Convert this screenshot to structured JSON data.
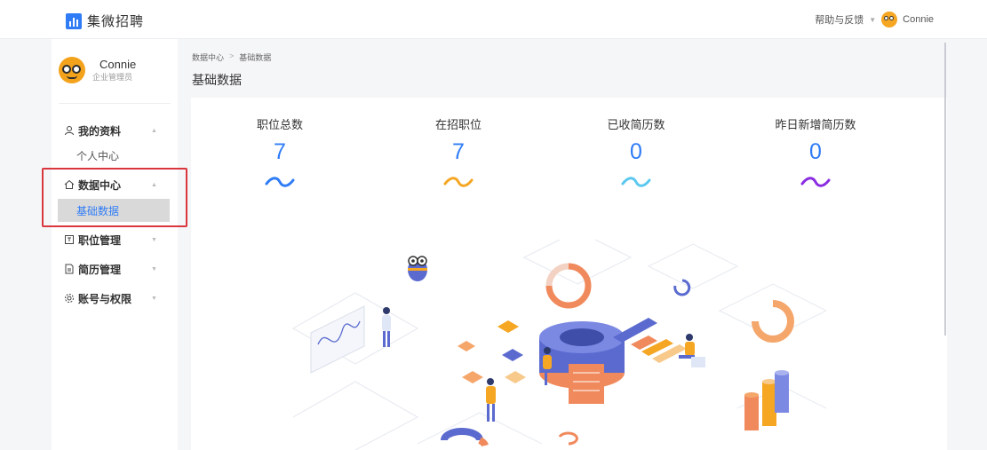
{
  "app": {
    "name": "集微招聘"
  },
  "header": {
    "help_label": "帮助与反馈",
    "user_name": "Connie"
  },
  "sidebar": {
    "user": {
      "name": "Connie",
      "role": "企业管理员"
    },
    "groups": [
      {
        "label": "我的资料",
        "icon": "user-icon",
        "sub": [
          "个人中心"
        ]
      },
      {
        "label": "数据中心",
        "icon": "home-icon",
        "sub": [
          "基础数据"
        ],
        "active_sub": "基础数据"
      },
      {
        "label": "职位管理",
        "icon": "position-icon"
      },
      {
        "label": "简历管理",
        "icon": "resume-icon"
      },
      {
        "label": "账号与权限",
        "icon": "gear-icon"
      }
    ]
  },
  "breadcrumb": {
    "items": [
      "数据中心",
      "基础数据"
    ],
    "separator": ">"
  },
  "page_title": "基础数据",
  "stats": [
    {
      "label": "职位总数",
      "value": "7",
      "wave_color": "#2f7cf6"
    },
    {
      "label": "在招职位",
      "value": "7",
      "wave_color": "#f5a623"
    },
    {
      "label": "已收简历数",
      "value": "0",
      "wave_color": "#5bc8f0"
    },
    {
      "label": "昨日新增简历数",
      "value": "0",
      "wave_color": "#8a2be2"
    }
  ],
  "colors": {
    "accent": "#2f7cf6",
    "highlight": "#d9363e"
  }
}
